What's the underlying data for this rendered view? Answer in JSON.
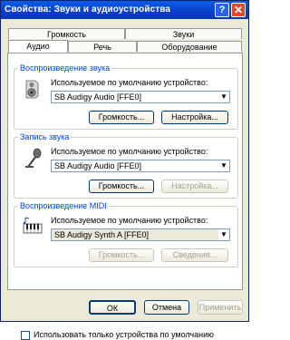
{
  "window": {
    "title": "Свойства: Звуки и аудиоустройства",
    "help_glyph": "?",
    "close_glyph": "✕"
  },
  "tabs": {
    "row1": [
      "Громкость",
      "Звуки"
    ],
    "row2": [
      "Аудио",
      "Речь",
      "Оборудование"
    ],
    "active": "Аудио"
  },
  "playback": {
    "group_label": "Воспроизведение звука",
    "device_label": "Используемое по умолчанию устройство:",
    "device_value": "SB Audigy Audio [FFE0]",
    "volume_button": "Громкость...",
    "settings_button": "Настройка...",
    "icon": "speaker-icon"
  },
  "recording": {
    "group_label": "Запись звука",
    "device_label": "Используемое по умолчанию устройство:",
    "device_value": "SB Audigy Audio [FFE0]",
    "volume_button": "Громкость...",
    "settings_button": "Настройка...",
    "icon": "microphone-icon"
  },
  "midi": {
    "group_label": "Воспроизведение MIDI",
    "device_label": "Используемое по умолчанию устройство:",
    "device_value": "SB Audigy Synth A [FFE0]",
    "volume_button": "Громкость...",
    "info_button": "Сведения...",
    "icon": "midi-keyboard-icon"
  },
  "checkbox": {
    "label": "Использовать только устройства по умолчанию",
    "checked": false
  },
  "footer": {
    "ok": "ОК",
    "cancel": "Отмена",
    "apply": "Применить"
  }
}
